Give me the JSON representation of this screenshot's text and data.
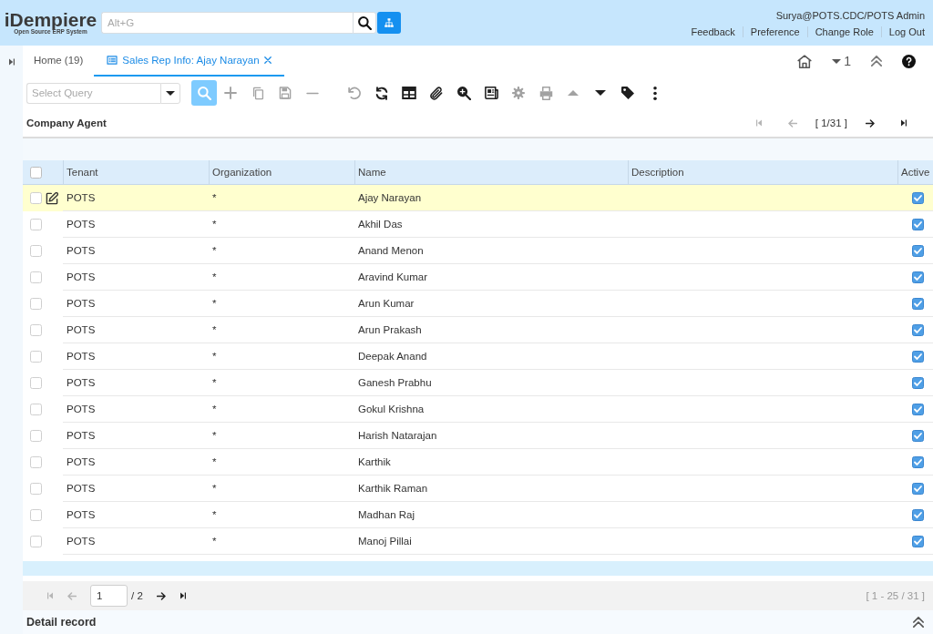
{
  "header": {
    "logo": {
      "name": "iDempiere",
      "tagline": "Open Source ERP System"
    },
    "search": {
      "placeholder": "Alt+G"
    },
    "user": "Surya@POTS.CDC/POTS Admin",
    "links": [
      "Feedback",
      "Preference",
      "Change Role",
      "Log Out"
    ]
  },
  "tabs": [
    {
      "kind": "home",
      "label": "Home (19)",
      "selected": false,
      "closable": false
    },
    {
      "kind": "window",
      "label": "Sales Rep Info: Ajay Narayan",
      "selected": true,
      "closable": true
    }
  ],
  "tab_tools": {
    "open_windows": "1"
  },
  "toolbar": {
    "query": {
      "placeholder": "Select Query"
    },
    "find": {
      "pressed": true
    },
    "groups": [
      {
        "buttons": [
          {
            "kind": "add",
            "disabled": true
          },
          {
            "kind": "copy",
            "disabled": true
          },
          {
            "kind": "save",
            "disabled": true
          },
          {
            "kind": "delete",
            "disabled": true
          }
        ]
      },
      {
        "buttons": [
          {
            "kind": "undo",
            "disabled": true
          },
          {
            "kind": "refresh",
            "disabled": false
          },
          {
            "kind": "grid",
            "disabled": false
          },
          {
            "kind": "attach",
            "disabled": false
          },
          {
            "kind": "zoom",
            "disabled": false
          },
          {
            "kind": "report",
            "disabled": false
          },
          {
            "kind": "settings",
            "disabled": true
          },
          {
            "kind": "print",
            "disabled": true
          },
          {
            "kind": "parent",
            "disabled": true
          },
          {
            "kind": "detail",
            "disabled": false
          },
          {
            "kind": "tag",
            "disabled": false
          },
          {
            "kind": "more",
            "disabled": false
          }
        ]
      }
    ]
  },
  "panel": {
    "title": "Company Agent",
    "record_nav": [
      {
        "kind": "first",
        "disabled": true
      },
      {
        "kind": "prev",
        "disabled": true
      },
      {
        "kind": "position",
        "label": "[ 1/31 ]"
      },
      {
        "kind": "next",
        "disabled": false
      },
      {
        "kind": "last",
        "disabled": false
      }
    ]
  },
  "table": {
    "select_all": {
      "checked": false
    },
    "columns": [
      "Tenant",
      "Organization",
      "Name",
      "Description",
      "Active"
    ],
    "rows": [
      {
        "tenant": "POTS",
        "organization": "*",
        "name": "Ajay Narayan",
        "checked": false,
        "current": true,
        "active": true
      },
      {
        "tenant": "POTS",
        "organization": "*",
        "name": "Akhil Das",
        "checked": false,
        "current": false,
        "active": true
      },
      {
        "tenant": "POTS",
        "organization": "*",
        "name": "Anand Menon",
        "checked": false,
        "current": false,
        "active": true
      },
      {
        "tenant": "POTS",
        "organization": "*",
        "name": "Aravind Kumar",
        "checked": false,
        "current": false,
        "active": true
      },
      {
        "tenant": "POTS",
        "organization": "*",
        "name": "Arun Kumar",
        "checked": false,
        "current": false,
        "active": true
      },
      {
        "tenant": "POTS",
        "organization": "*",
        "name": "Arun Prakash",
        "checked": false,
        "current": false,
        "active": true
      },
      {
        "tenant": "POTS",
        "organization": "*",
        "name": "Deepak Anand",
        "checked": false,
        "current": false,
        "active": true
      },
      {
        "tenant": "POTS",
        "organization": "*",
        "name": "Ganesh Prabhu",
        "checked": false,
        "current": false,
        "active": true
      },
      {
        "tenant": "POTS",
        "organization": "*",
        "name": "Gokul Krishna",
        "checked": false,
        "current": false,
        "active": true
      },
      {
        "tenant": "POTS",
        "organization": "*",
        "name": "Harish Natarajan",
        "checked": false,
        "current": false,
        "active": true
      },
      {
        "tenant": "POTS",
        "organization": "*",
        "name": "Karthik",
        "checked": false,
        "current": false,
        "active": true
      },
      {
        "tenant": "POTS",
        "organization": "*",
        "name": "Karthik Raman",
        "checked": false,
        "current": false,
        "active": true
      },
      {
        "tenant": "POTS",
        "organization": "*",
        "name": "Madhan Raj",
        "checked": false,
        "current": false,
        "active": true
      },
      {
        "tenant": "POTS",
        "organization": "*",
        "name": "Manoj Pillai",
        "checked": false,
        "current": false,
        "active": true
      }
    ]
  },
  "paging": {
    "controls": [
      {
        "kind": "first",
        "disabled": true
      },
      {
        "kind": "prev",
        "disabled": true
      },
      {
        "kind": "page_input",
        "value": "1"
      },
      {
        "kind": "page_total",
        "label": "/ 2"
      },
      {
        "kind": "next",
        "disabled": false
      },
      {
        "kind": "last",
        "disabled": false
      }
    ],
    "summary": "[ 1 - 25 / 31 ]"
  },
  "detail": {
    "title": "Detail record"
  }
}
